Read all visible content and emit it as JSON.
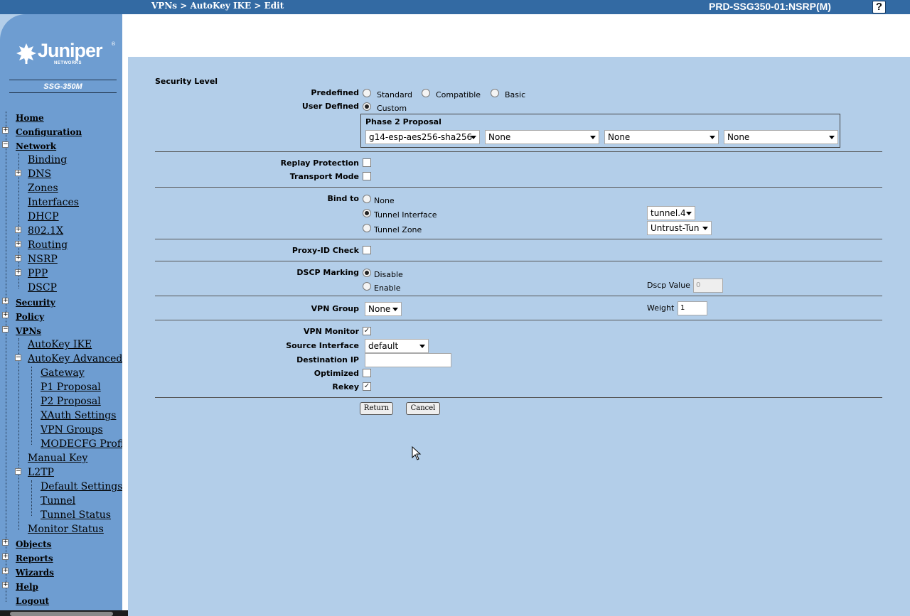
{
  "header": {
    "breadcrumb": "VPNs > AutoKey IKE > Edit",
    "device": "PRD-SSG350-01:NSRP(M)",
    "help": "?"
  },
  "sidebar": {
    "brand": "Juniper",
    "brand_sub": "NETWORKS",
    "brand_reg": "®",
    "model": "SSG-350M",
    "nav": {
      "home": "Home",
      "configuration": "Configuration",
      "network": "Network",
      "binding": "Binding",
      "dns": "DNS",
      "zones": "Zones",
      "interfaces": "Interfaces",
      "dhcp": "DHCP",
      "dot1x": "802.1X",
      "routing": "Routing",
      "nsrp": "NSRP",
      "ppp": "PPP",
      "dscp": "DSCP",
      "security": "Security",
      "policy": "Policy",
      "vpns": "VPNs",
      "autokey_ike": "AutoKey IKE",
      "autokey_advanced": "AutoKey Advanced",
      "gateway": "Gateway",
      "p1_proposal": "P1 Proposal",
      "p2_proposal": "P2 Proposal",
      "xauth_settings": "XAuth Settings",
      "vpn_groups": "VPN Groups",
      "modecfg_profile": "MODECFG Profile",
      "manual_key": "Manual Key",
      "l2tp": "L2TP",
      "default_settings": "Default Settings",
      "tunnel": "Tunnel",
      "tunnel_status": "Tunnel Status",
      "monitor_status": "Monitor Status",
      "objects": "Objects",
      "reports": "Reports",
      "wizards": "Wizards",
      "help": "Help",
      "logout": "Logout"
    },
    "toggle_plus": "+",
    "toggle_minus": "−"
  },
  "form": {
    "security_level": "Security Level",
    "predefined": "Predefined",
    "opt_standard": "Standard",
    "opt_compatible": "Compatible",
    "opt_basic": "Basic",
    "user_defined": "User Defined",
    "opt_custom": "Custom",
    "phase2_title": "Phase 2 Proposal",
    "p2_1": "g14-esp-aes256-sha256",
    "p2_2": "None",
    "p2_3": "None",
    "p2_4": "None",
    "replay_protection": "Replay Protection",
    "transport_mode": "Transport Mode",
    "bind_to": "Bind to",
    "bind_none": "None",
    "bind_tunnel_interface": "Tunnel Interface",
    "bind_tunnel_zone": "Tunnel Zone",
    "tunnel_interface_value": "tunnel.4",
    "tunnel_zone_value": "Untrust-Tun",
    "proxy_id_check": "Proxy-ID Check",
    "dscp_marking": "DSCP Marking",
    "dscp_disable": "Disable",
    "dscp_enable": "Enable",
    "dscp_value_label": "Dscp Value",
    "dscp_value": "0",
    "vpn_group": "VPN Group",
    "vpn_group_value": "None",
    "weight_label": "Weight",
    "weight_value": "1",
    "vpn_monitor": "VPN Monitor",
    "source_interface": "Source Interface",
    "source_interface_value": "default",
    "destination_ip": "Destination IP",
    "destination_ip_value": "",
    "optimized": "Optimized",
    "rekey": "Rekey",
    "return_button": "Return",
    "cancel_button": "Cancel",
    "check_mark": "✓"
  },
  "state": {
    "security_level": "Custom",
    "replay_protection": false,
    "transport_mode": false,
    "bind_to": "Tunnel Interface",
    "proxy_id_check": false,
    "dscp_marking": "Disable",
    "vpn_monitor": true,
    "optimized": false,
    "rekey": true
  },
  "colors": {
    "topbar": "#336aa3",
    "sidebar": "#6e9dd1",
    "content": "#b3cee9"
  }
}
